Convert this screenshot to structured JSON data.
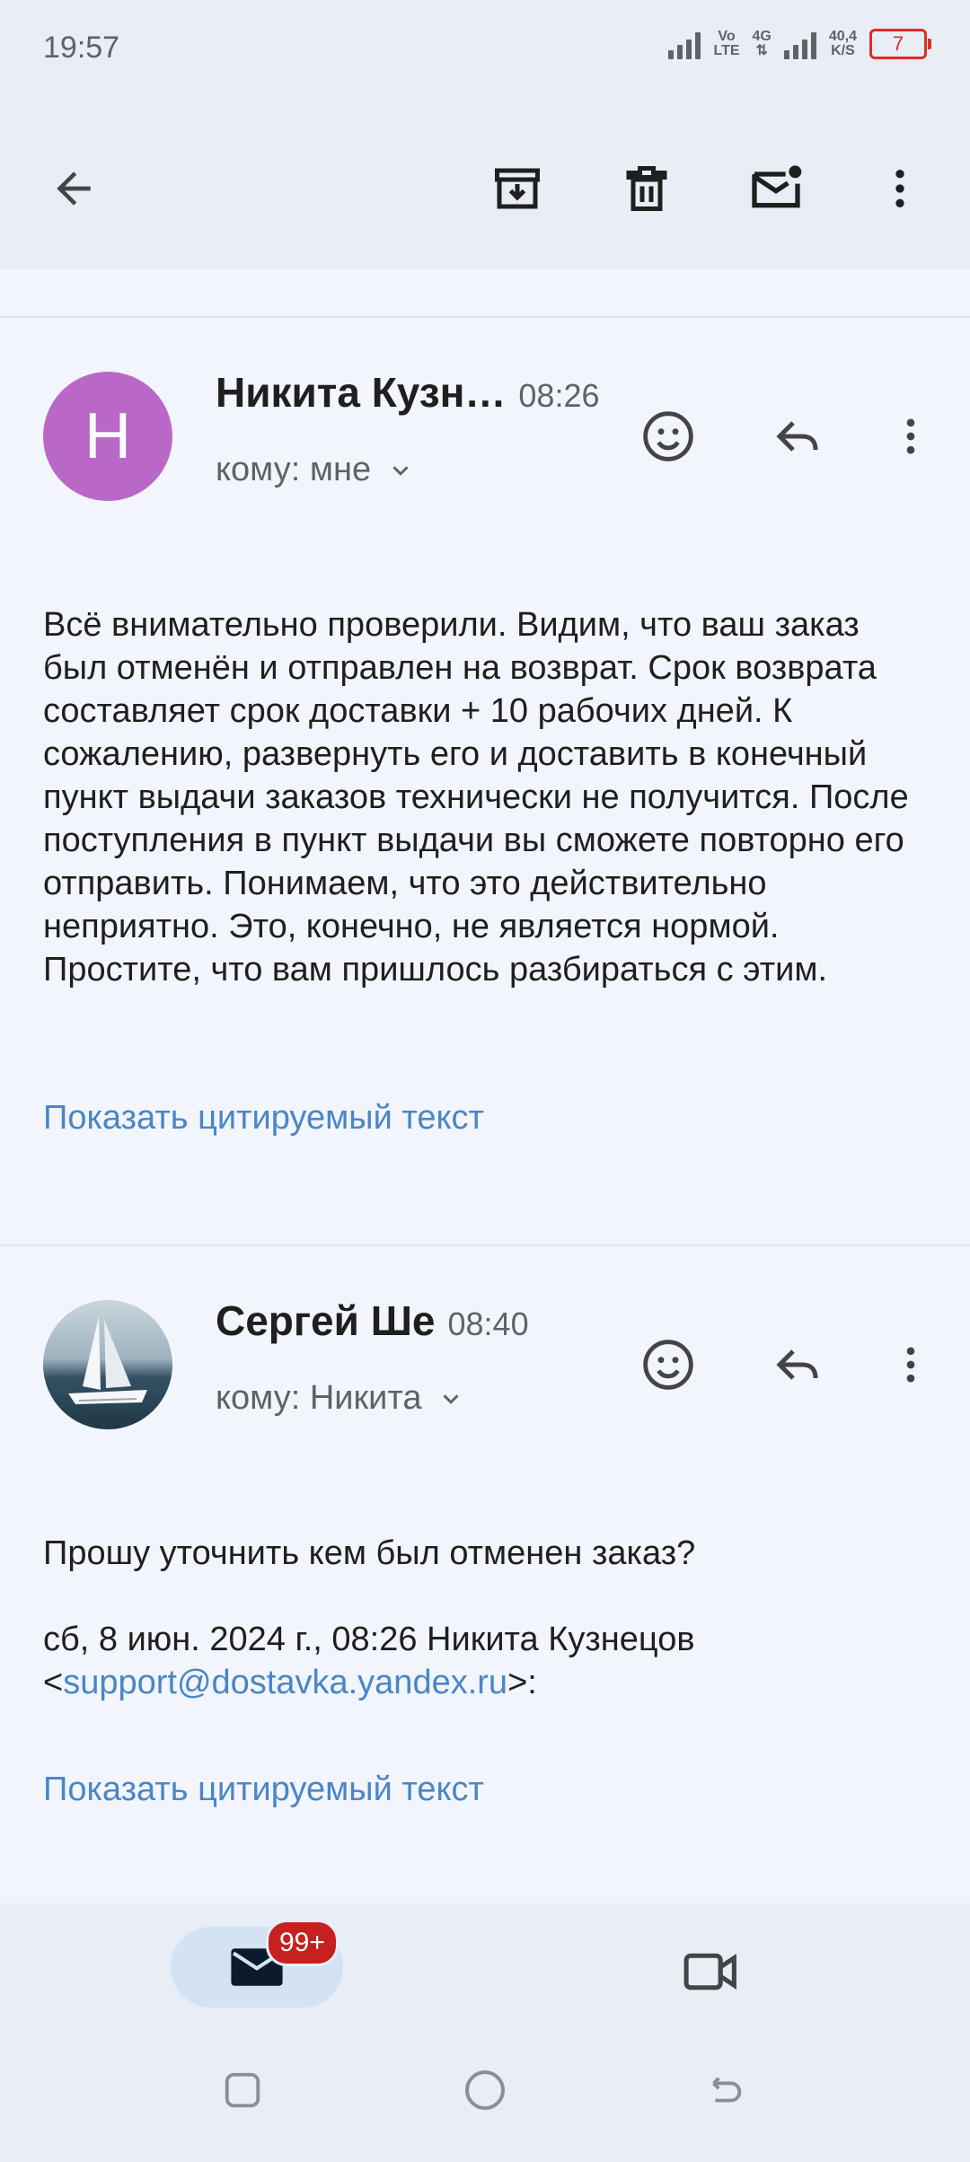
{
  "status_bar": {
    "time": "19:57",
    "net_1": "Vo",
    "net_2": "LTE",
    "net_3": "4G",
    "speed_1": "40,4",
    "speed_2": "K/S",
    "battery": "7"
  },
  "toolbar": {
    "back_icon": "arrow-left-icon",
    "archive_icon": "archive-icon",
    "delete_icon": "trash-icon",
    "mark_unread_icon": "mail-unread-icon",
    "more_icon": "more-vert-icon"
  },
  "messages": [
    {
      "avatar_letter": "Н",
      "avatar_color": "#ba68c8",
      "sender": "Никита Кузн…",
      "time": "08:26",
      "recipient": "кому: мне",
      "body": "Всё внимательно проверили. Видим, что ваш заказ был отменён и отправлен на возврат. Срок возврата составляет срок доставки + 10 рабочих дней. К сожалению, развернуть его и доставить в конечный пункт выдачи заказов технически не получится. После поступления в пункт выдачи вы сможете повторно его отправить. Понимаем, что это действительно неприятно. Это, конечно, не является нормой. Простите, что вам пришлось разбираться с этим.",
      "show_quoted": "Показать цитируемый текст"
    },
    {
      "sender": "Сергей Ше",
      "time": "08:40",
      "recipient": "кому: Никита",
      "body": "Прошу уточнить кем был отменен заказ?",
      "quote_header_1": "сб, 8 июн. 2024 г., 08:26 Никита Кузнецов",
      "quote_lt": "<",
      "quote_email": "support@dostavka.yandex.ru",
      "quote_gt": ">:",
      "show_quoted": "Показать цитируемый текст"
    }
  ],
  "bottom_nav": {
    "mail_badge": "99+",
    "accent": "#d3e3f3"
  },
  "colors": {
    "link": "#4a86c8",
    "badge": "#c5221f",
    "battery": "#d93025"
  }
}
